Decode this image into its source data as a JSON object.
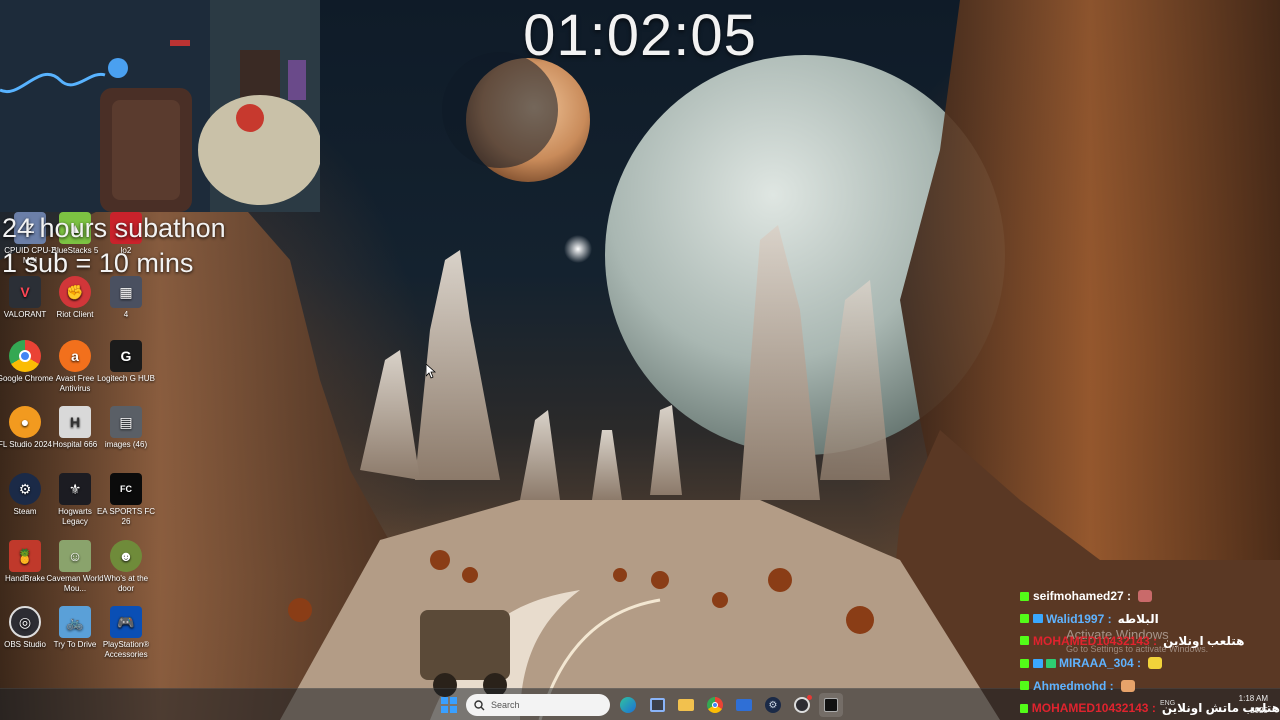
{
  "stream": {
    "timer": "01:02:05",
    "overlay_line1": "24 hours subathon",
    "overlay_line2": "1 sub = 10 mins"
  },
  "desktop_icons": [
    {
      "label": "CPUID CPU-Z MSI",
      "icon": "cpuz-icon",
      "color": "#6b7fa8"
    },
    {
      "label": "BlueStacks 5",
      "icon": "bluestacks-icon",
      "color": "#7cc242"
    },
    {
      "label": "lo2",
      "icon": "folder-icon",
      "color": "#c9222b"
    },
    {
      "label": "VALORANT",
      "icon": "valorant-icon",
      "color": "#2b2f36"
    },
    {
      "label": "Riot Client",
      "icon": "riot-icon",
      "color": "#d13639"
    },
    {
      "label": "4",
      "icon": "image-icon",
      "color": "#4a5060"
    },
    {
      "label": "Google Chrome",
      "icon": "chrome-icon",
      "color": "#4285f4"
    },
    {
      "label": "Avast Free Antivirus",
      "icon": "avast-icon",
      "color": "#f2701c"
    },
    {
      "label": "Logitech G HUB",
      "icon": "logitech-icon",
      "color": "#1b1b1b"
    },
    {
      "label": "FL Studio 2024",
      "icon": "flstudio-icon",
      "color": "#f29a1f"
    },
    {
      "label": "Hospital 666",
      "icon": "hospital-icon",
      "color": "#d9d9d9"
    },
    {
      "label": "images (46)",
      "icon": "image-icon",
      "color": "#5a5f66"
    },
    {
      "label": "Steam",
      "icon": "steam-icon",
      "color": "#1b2a47"
    },
    {
      "label": "Hogwarts Legacy",
      "icon": "hogwarts-icon",
      "color": "#1c1c22"
    },
    {
      "label": "EA SPORTS FC 26",
      "icon": "easports-icon",
      "color": "#0b0b0b"
    },
    {
      "label": "HandBrake",
      "icon": "handbrake-icon",
      "color": "#c0392b"
    },
    {
      "label": "Caveman World Mou...",
      "icon": "caveman-icon",
      "color": "#8aa36c"
    },
    {
      "label": "Who's at the door",
      "icon": "whosatthedoor-icon",
      "color": "#6f8b3a"
    },
    {
      "label": "OBS Studio",
      "icon": "obs-icon",
      "color": "#2d2d33"
    },
    {
      "label": "Try To Drive",
      "icon": "trytodrive-icon",
      "color": "#5aa0d8"
    },
    {
      "label": "PlayStation® Accessories",
      "icon": "playstation-icon",
      "color": "#0a4fb5"
    }
  ],
  "chat": [
    {
      "name": "seifmohamed27 :",
      "name_color": "#ffffff",
      "sub_badge": false,
      "message": "",
      "emote_color": "#c96a6a"
    },
    {
      "name": "Walid1997 :",
      "name_color": "#5fb3ff",
      "sub_badge": true,
      "message": "البلاطه",
      "emote_color": ""
    },
    {
      "name": "MOHAMED10432143 :",
      "name_color": "#e0232e",
      "sub_badge": false,
      "message": "هتلعب اونلاين",
      "emote_color": ""
    },
    {
      "name": "MIRAAA_304 :",
      "name_color": "#5fb3ff",
      "sub_badge": true,
      "message": "",
      "emote_color": "#f2d33a"
    },
    {
      "name": "Ahmedmohd :",
      "name_color": "#5fb3ff",
      "sub_badge": false,
      "message": "",
      "emote_color": "#e7a36a"
    },
    {
      "name": "MOHAMED10432143 :",
      "name_color": "#e0232e",
      "sub_badge": false,
      "message": "هتلعب ماتش اونلاين",
      "emote_color": ""
    }
  ],
  "activation": {
    "title": "Activate Windows",
    "subtitle": "Go to Settings to activate Windows."
  },
  "taskbar": {
    "search_placeholder": "Search",
    "pinned": [
      "file-explorer-icon",
      "edge-icon",
      "store-icon",
      "folder-icon",
      "chrome-icon",
      "mail-icon",
      "steam-icon",
      "obs-icon",
      "app-icon"
    ],
    "language": "ENG",
    "time": "1:18 AM",
    "date": "2025"
  }
}
